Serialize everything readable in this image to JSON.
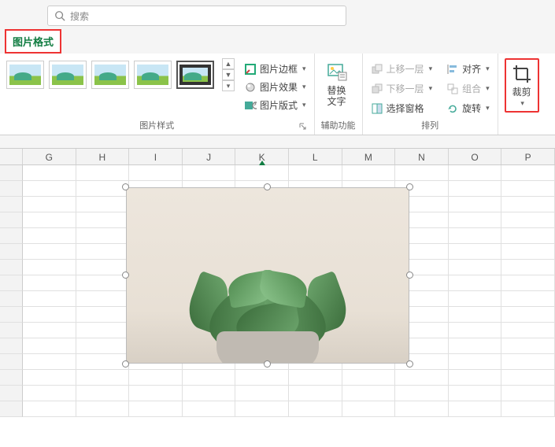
{
  "search": {
    "placeholder": "搜索"
  },
  "tab": {
    "label": "图片格式"
  },
  "ribbon": {
    "styles_label": "图片样式",
    "border": "图片边框",
    "effects": "图片效果",
    "layout": "图片版式",
    "alt_text": "替换\n文字",
    "accessibility_label": "辅助功能",
    "bring_forward": "上移一层",
    "send_backward": "下移一层",
    "selection_pane": "选择窗格",
    "align": "对齐",
    "group": "组合",
    "rotate": "旋转",
    "arrange_label": "排列",
    "crop": "裁剪"
  },
  "columns": [
    "G",
    "H",
    "I",
    "J",
    "K",
    "L",
    "M",
    "N",
    "O",
    "P"
  ],
  "active_column": "K"
}
